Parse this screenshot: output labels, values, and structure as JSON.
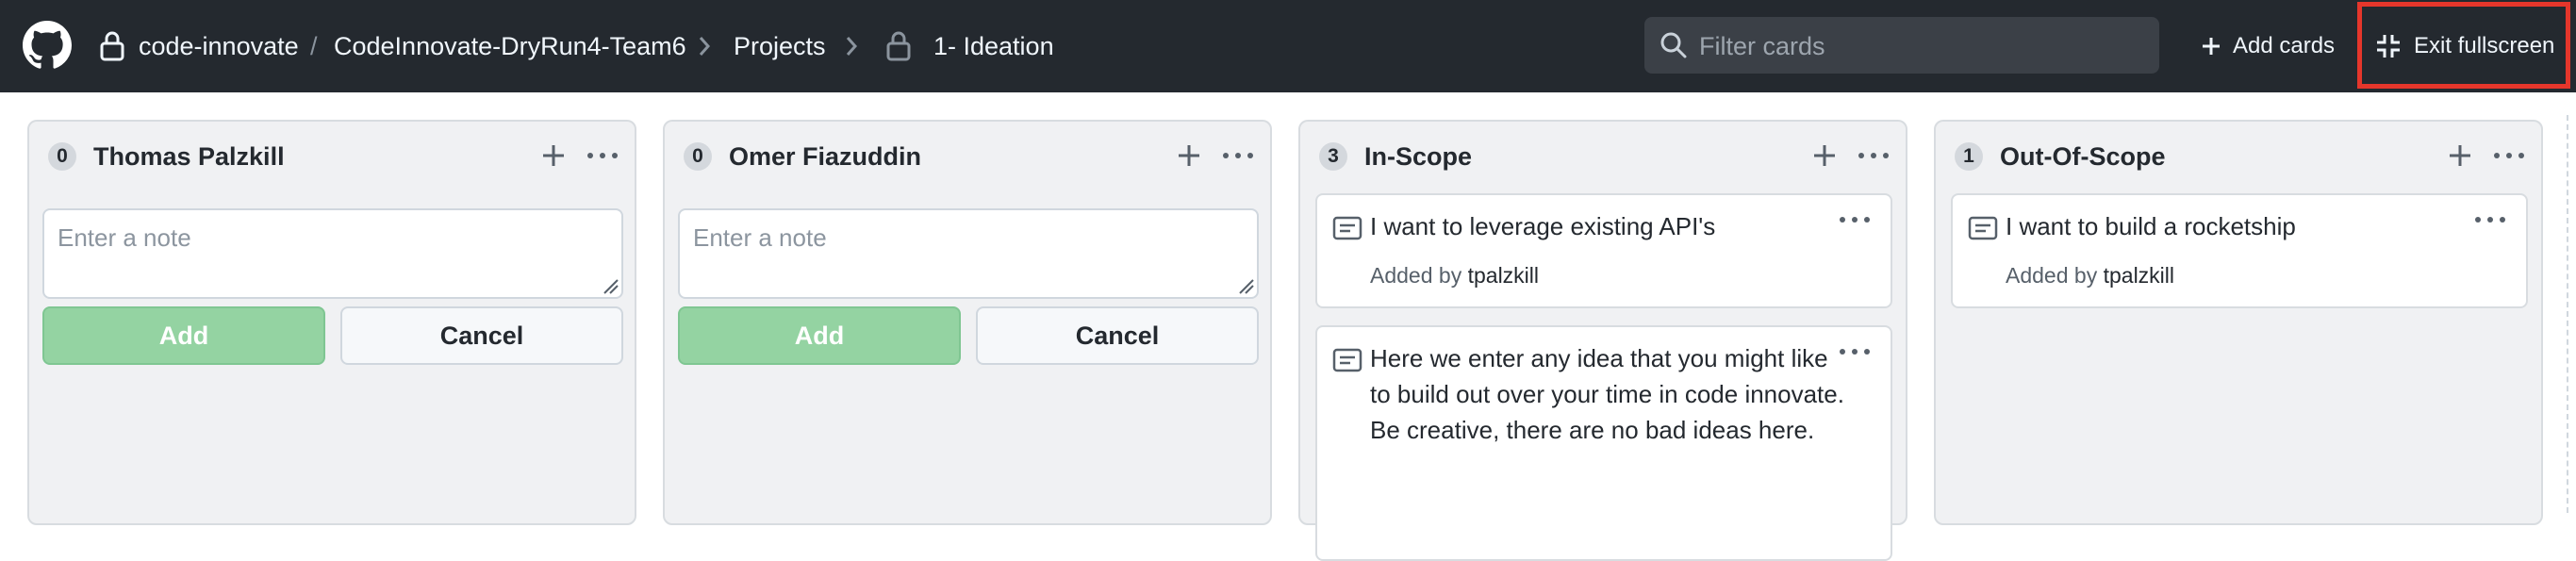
{
  "header": {
    "breadcrumb": {
      "owner": "code-innovate",
      "separator": "/",
      "repo": "CodeInnovate-DryRun4-Team6",
      "section": "Projects",
      "project": "1- Ideation"
    },
    "search": {
      "placeholder": "Filter cards",
      "value": ""
    },
    "add_cards_label": "Add cards",
    "exit_fullscreen_label": "Exit fullscreen"
  },
  "columns": [
    {
      "count": "0",
      "title": "Thomas Palzkill",
      "note_placeholder": "Enter a note",
      "add_label": "Add",
      "cancel_label": "Cancel"
    },
    {
      "count": "0",
      "title": "Omer Fiazuddin",
      "note_placeholder": "Enter a note",
      "add_label": "Add",
      "cancel_label": "Cancel"
    },
    {
      "count": "3",
      "title": "In-Scope",
      "cards": [
        {
          "text": "I want to leverage existing API's",
          "added_by_label": "Added by",
          "author": "tpalzkill"
        },
        {
          "text": "Here we enter any idea that you might like to build out over your time in code innovate. Be creative, there are no bad ideas here."
        }
      ]
    },
    {
      "count": "1",
      "title": "Out-Of-Scope",
      "cards": [
        {
          "text": "I want to build a rocketship",
          "added_by_label": "Added by",
          "author": "tpalzkill"
        }
      ]
    }
  ],
  "colors": {
    "header_bg": "#24292f",
    "add_button": "#94d3a2",
    "column_bg": "#f0f1f3",
    "highlight": "#e5362b"
  }
}
